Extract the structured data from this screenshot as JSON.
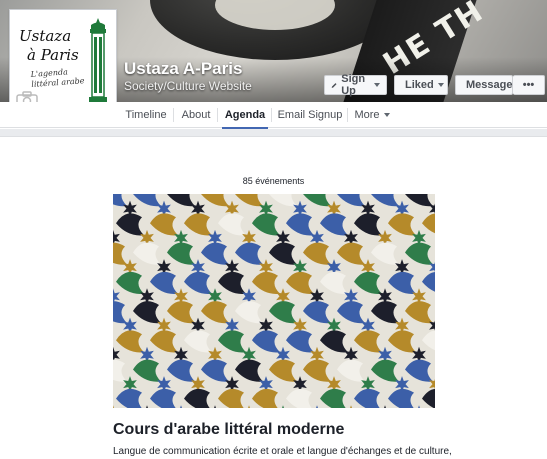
{
  "page": {
    "name": "Ustaza A-Paris",
    "category": "Society/Culture Website",
    "cover_text": "HE TH"
  },
  "profile": {
    "logo_line1": "Ustaza",
    "logo_line2": "à Paris",
    "logo_tagline": "L'agenda littéral arabe"
  },
  "actions": {
    "signup_label": "Sign Up",
    "liked_label": "Liked",
    "message_label": "Message",
    "more_label": "•••"
  },
  "nav": {
    "tabs": [
      "Timeline",
      "About",
      "Agenda",
      "Email Signup",
      "More"
    ],
    "active": "Agenda"
  },
  "events": {
    "count_label": "85 événements",
    "title": "Cours d'arabe littéral moderne",
    "description": "Langue de communication écrite et orale et langue d'échanges et de culture,"
  },
  "colors": {
    "accent": "#4267b2",
    "tower_green": "#1f7a3a",
    "mosaic_blue": "#3c5fa8",
    "mosaic_gold": "#b58a2a",
    "mosaic_green": "#2f7d4a",
    "mosaic_dark": "#1d1f2b"
  }
}
